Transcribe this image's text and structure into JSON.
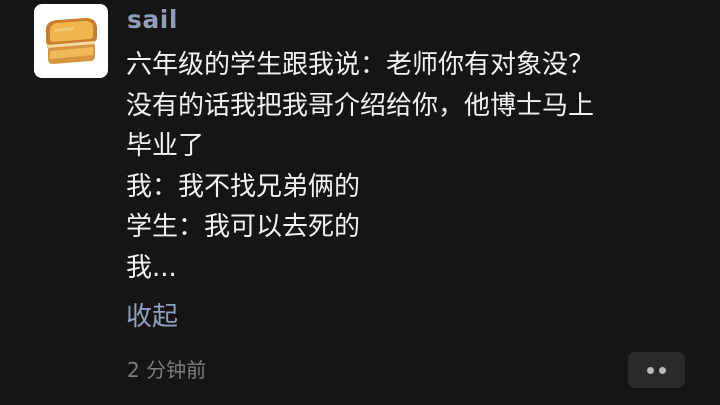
{
  "comment": {
    "username": "sail",
    "avatar_icon": "toast-sandwich-icon",
    "body_lines": [
      "六年级的学生跟我说：老师你有对象没？",
      "没有的话我把我哥介绍给你，他博士马上",
      "毕业了",
      "我：我不找兄弟俩的",
      "学生：我可以去死的",
      "我..."
    ],
    "collapse_label": "收起",
    "timestamp": "2 分钟前",
    "more_icon": "more-dots-icon"
  },
  "colors": {
    "background": "#151515",
    "username": "#8f9fb7",
    "body_text": "#f2f2f2",
    "link": "#8ea0bd",
    "timestamp": "#7c7c7c",
    "more_button_bg": "#2a2a2c"
  }
}
